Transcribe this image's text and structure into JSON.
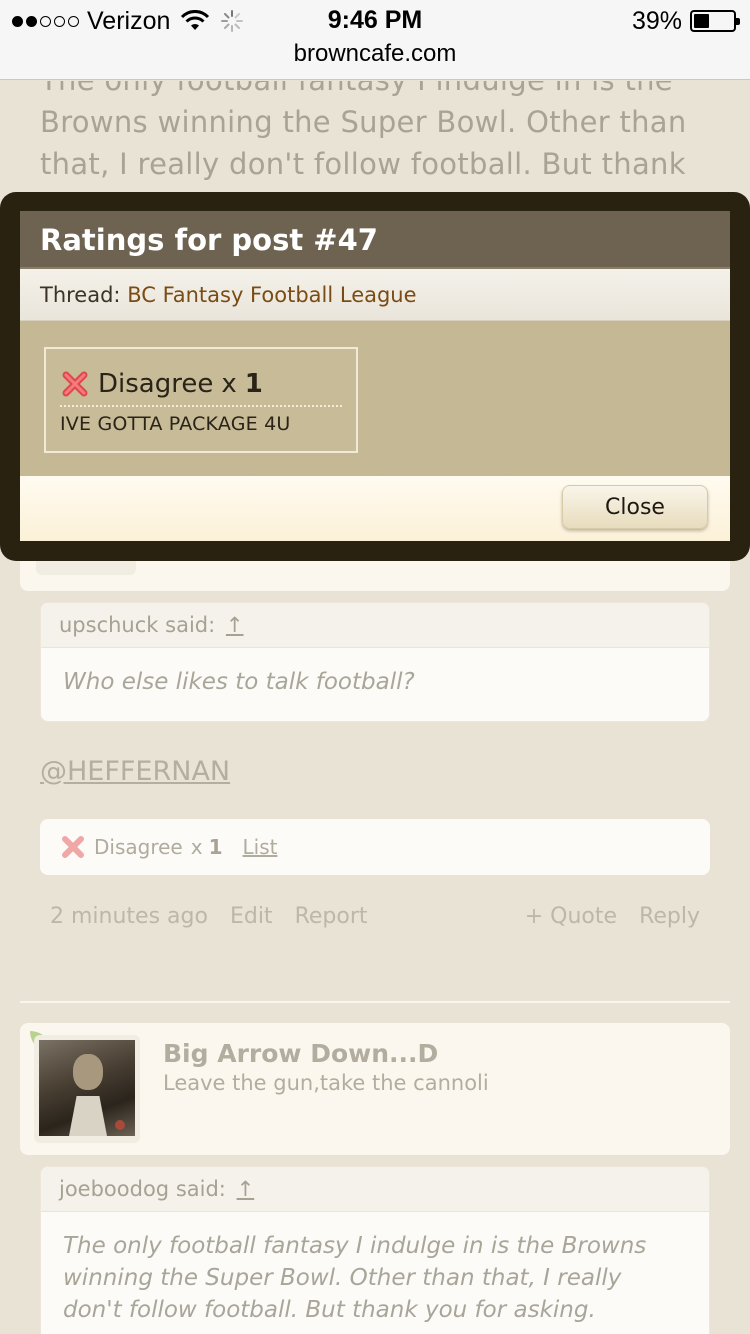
{
  "status_bar": {
    "carrier": "Verizon",
    "signal_bars": 2,
    "time": "9:46 PM",
    "battery_percent": "39%",
    "battery_level": 0.39,
    "url": "browncafe.com"
  },
  "background": {
    "top_text": "The only football fantasy I indulge in is the Browns winning the Super Bowl. Other than that, I really don't follow football. But thank",
    "quote1": {
      "author": "upschuck said:",
      "arrow": "↑",
      "text": "Who else likes to talk football?"
    },
    "mention": "@HEFFERNAN",
    "rating_summary": {
      "label": "Disagree",
      "times": "x",
      "count": "1",
      "list_link": "List"
    },
    "meta": {
      "time": "2 minutes ago",
      "edit": "Edit",
      "report": "Report",
      "quote": "+ Quote",
      "reply": "Reply"
    },
    "user": {
      "name": "Big Arrow Down...D",
      "title": "Leave the gun,take the cannoli"
    },
    "quote2": {
      "author": "joeboodog said:",
      "arrow": "↑",
      "text": "The only football fantasy I indulge in is the Browns winning the Super Bowl. Other than that, I really don't follow football. But thank you for asking."
    }
  },
  "dialog": {
    "title": "Ratings for post #47",
    "thread_label": "Thread:",
    "thread_name": "BC Fantasy Football League",
    "rating": {
      "label": "Disagree",
      "times": "x",
      "count": "1",
      "user": "IVE GOTTA PACKAGE 4U"
    },
    "close_label": "Close"
  },
  "colors": {
    "overlay_frame": "#2a2210",
    "title_bar": "#6e6250",
    "thread_link": "#7a4c14",
    "rating_body": "#c5b895",
    "disagree_red": "#e0474c"
  }
}
